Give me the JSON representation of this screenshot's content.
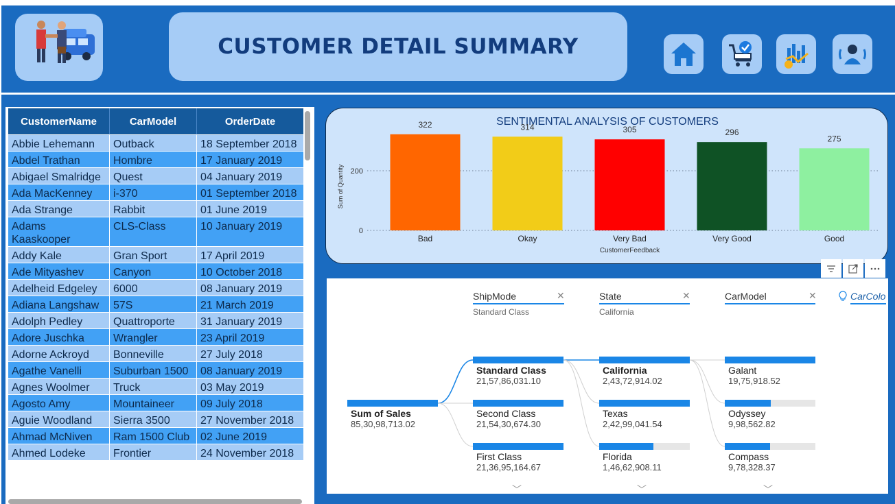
{
  "header": {
    "title": "CUSTOMER DETAIL SUMMARY",
    "logo_icon": "customer-handshake-car-icon",
    "nav": [
      {
        "name": "home-icon"
      },
      {
        "name": "cart-check-icon"
      },
      {
        "name": "sales-chart-icon"
      },
      {
        "name": "customer-profile-icon"
      }
    ]
  },
  "table": {
    "columns": [
      "CustomerName",
      "CarModel",
      "OrderDate"
    ],
    "rows": [
      [
        "Abbie Lehemann",
        "Outback",
        "18 September 2018"
      ],
      [
        "Abdel Trathan",
        "Hombre",
        "17 January 2019"
      ],
      [
        "Abigael Smalridge",
        "Quest",
        "04 January 2019"
      ],
      [
        "Ada MacKenney",
        "i-370",
        "01 September 2018"
      ],
      [
        "Ada Strange",
        "Rabbit",
        "01 June 2019"
      ],
      [
        "Adams Kaaskooper",
        "CLS-Class",
        "10 January 2019"
      ],
      [
        "Addy Kale",
        "Gran Sport",
        "17 April 2019"
      ],
      [
        "Ade Mityashev",
        "Canyon",
        "10 October 2018"
      ],
      [
        "Adelheid Edgeley",
        "6000",
        "08 January 2019"
      ],
      [
        "Adiana Langshaw",
        "57S",
        "21 March 2019"
      ],
      [
        "Adolph Pedley",
        "Quattroporte",
        "31 January 2019"
      ],
      [
        "Adore Juschka",
        "Wrangler",
        "23 April 2019"
      ],
      [
        "Adorne Ackroyd",
        "Bonneville",
        "27 July 2018"
      ],
      [
        "Agathe Vanelli",
        "Suburban 1500",
        "08 January 2019"
      ],
      [
        "Agnes Woolmer",
        "Truck",
        "03 May 2019"
      ],
      [
        "Agosto Amy",
        "Mountaineer",
        "09 July 2018"
      ],
      [
        "Aguie Woodland",
        "Sierra 3500",
        "27 November 2018"
      ],
      [
        "Ahmad McNiven",
        "Ram 1500 Club",
        "02 June 2019"
      ],
      [
        "Ahmed Lodeke",
        "Frontier",
        "24 November 2018"
      ]
    ]
  },
  "chart_data": {
    "type": "bar",
    "title": "SENTIMENTAL ANALYSIS OF CUSTOMERS",
    "xlabel": "CustomerFeedback",
    "ylabel": "Sum of Quantity",
    "categories": [
      "Bad",
      "Okay",
      "Very Bad",
      "Very Good",
      "Good"
    ],
    "values": [
      322,
      314,
      305,
      296,
      275
    ],
    "colors": [
      "#ff6600",
      "#f2cc18",
      "#ff0000",
      "#0f5225",
      "#8ef0a0"
    ],
    "yticks": [
      0,
      200
    ],
    "ylim": [
      0,
      340
    ],
    "grid": "dotted horizontal",
    "data_labels": [
      "322",
      "314",
      "305",
      "296",
      "275"
    ]
  },
  "decomposition": {
    "root": {
      "label": "Sum of Sales",
      "value": "85,30,98,713.02"
    },
    "levels": [
      {
        "field": "ShipMode",
        "selected": "Standard Class",
        "nodes": [
          {
            "label": "Standard Class",
            "value": "21,57,86,031.10",
            "share": 1.0
          },
          {
            "label": "Second Class",
            "value": "21,54,30,674.30",
            "share": 1.0
          },
          {
            "label": "First Class",
            "value": "21,36,95,164.67",
            "share": 1.0
          }
        ]
      },
      {
        "field": "State",
        "selected": "California",
        "nodes": [
          {
            "label": "California",
            "value": "2,43,72,914.02",
            "share": 1.0
          },
          {
            "label": "Texas",
            "value": "2,42,99,041.54",
            "share": 1.0
          },
          {
            "label": "Florida",
            "value": "1,46,62,908.11",
            "share": 0.6
          }
        ]
      },
      {
        "field": "CarModel",
        "selected": "",
        "nodes": [
          {
            "label": "Galant",
            "value": "19,75,918.52",
            "share": 1.0
          },
          {
            "label": "Odyssey",
            "value": "9,98,562.82",
            "share": 0.51
          },
          {
            "label": "Compass",
            "value": "9,78,328.37",
            "share": 0.5
          }
        ]
      }
    ],
    "next_field": "CarColo"
  },
  "toolbar": {
    "filter": "filter-icon",
    "focus": "focus-mode-icon",
    "more": "more-options-icon"
  }
}
